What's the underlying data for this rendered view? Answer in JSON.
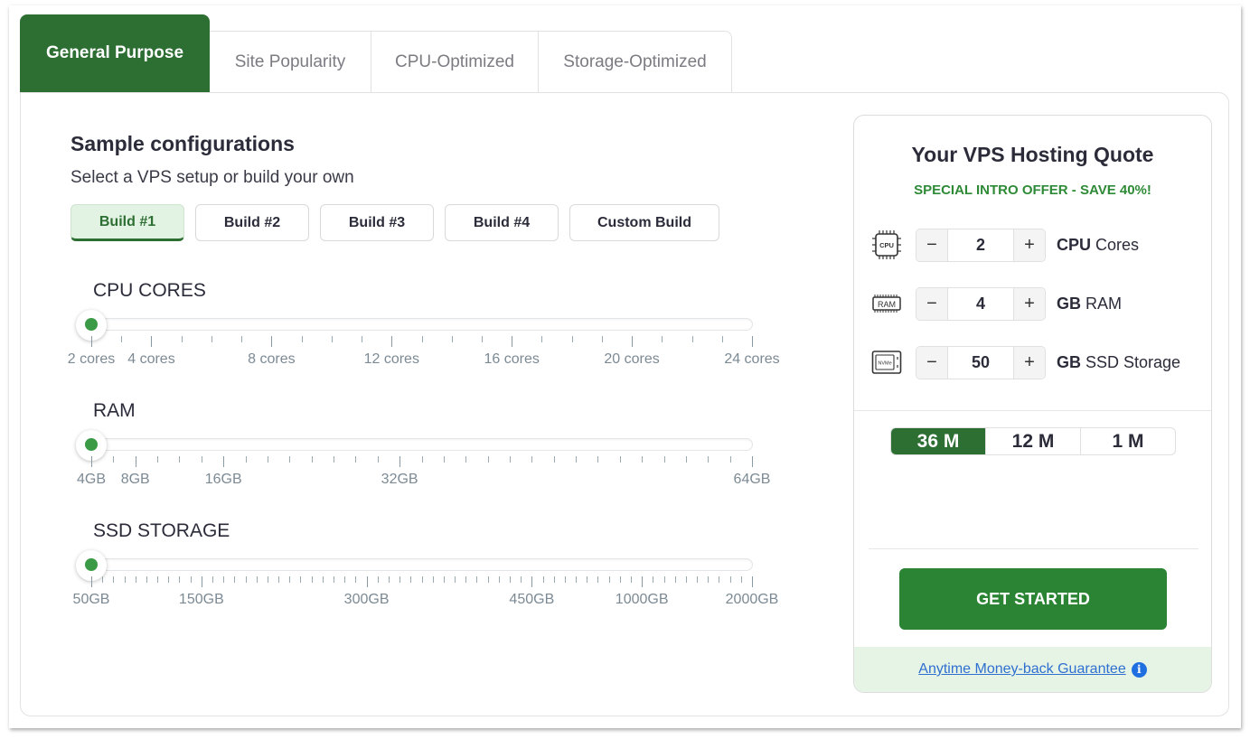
{
  "tabs": [
    {
      "label": "General Purpose",
      "active": true
    },
    {
      "label": "Site Popularity",
      "active": false
    },
    {
      "label": "CPU-Optimized",
      "active": false
    },
    {
      "label": "Storage-Optimized",
      "active": false
    }
  ],
  "configurator": {
    "title": "Sample configurations",
    "subtitle": "Select a VPS setup or build your own",
    "builds": [
      {
        "label": "Build #1",
        "selected": true
      },
      {
        "label": "Build #2",
        "selected": false
      },
      {
        "label": "Build #3",
        "selected": false
      },
      {
        "label": "Build #4",
        "selected": false
      },
      {
        "label": "Custom Build",
        "selected": false
      }
    ],
    "sliders": {
      "cpu": {
        "label": "CPU CORES",
        "value": 2,
        "min": 2,
        "max": 24,
        "tick_count": 23,
        "major_ticks": [
          2,
          4,
          8,
          12,
          16,
          20,
          24
        ],
        "tick_labels": [
          {
            "value": 2,
            "text": "2 cores"
          },
          {
            "value": 4,
            "text": "4 cores"
          },
          {
            "value": 8,
            "text": "8 cores"
          },
          {
            "value": 12,
            "text": "12 cores"
          },
          {
            "value": 16,
            "text": "16 cores"
          },
          {
            "value": 20,
            "text": "20 cores"
          },
          {
            "value": 24,
            "text": "24 cores"
          }
        ]
      },
      "ram": {
        "label": "RAM",
        "value": 4,
        "min": 4,
        "max": 64,
        "tick_count": 31,
        "major_ticks_index": [
          0,
          2,
          6,
          14,
          30
        ],
        "tick_labels": [
          {
            "index": 0,
            "text": "4GB"
          },
          {
            "index": 2,
            "text": "8GB"
          },
          {
            "index": 6,
            "text": "16GB"
          },
          {
            "index": 14,
            "text": "32GB"
          },
          {
            "index": 30,
            "text": "64GB"
          }
        ]
      },
      "ssd": {
        "label": "SSD STORAGE",
        "value": 50,
        "tick_count": 61,
        "major_ticks_index": [
          0,
          10,
          25,
          40,
          50,
          60
        ],
        "tick_labels": [
          {
            "index": 0,
            "text": "50GB"
          },
          {
            "index": 10,
            "text": "150GB"
          },
          {
            "index": 25,
            "text": "300GB"
          },
          {
            "index": 40,
            "text": "450GB"
          },
          {
            "index": 50,
            "text": "1000GB"
          },
          {
            "index": 60,
            "text": "2000GB"
          }
        ]
      }
    }
  },
  "quote": {
    "title": "Your VPS Hosting Quote",
    "offer": "SPECIAL INTRO OFFER - SAVE 40%!",
    "specs": [
      {
        "icon": "cpu-chip-icon",
        "value": "2",
        "unit_bold": "CPU",
        "unit_rest": " Cores",
        "minus": "−",
        "plus": "+"
      },
      {
        "icon": "ram-module-icon",
        "value": "4",
        "unit_bold": "GB",
        "unit_rest": " RAM",
        "minus": "−",
        "plus": "+"
      },
      {
        "icon": "nvme-ssd-icon",
        "value": "50",
        "unit_bold": "GB",
        "unit_rest": " SSD Storage",
        "minus": "−",
        "plus": "+"
      }
    ],
    "terms": [
      {
        "label": "36 M",
        "active": true
      },
      {
        "label": "12 M",
        "active": false
      },
      {
        "label": "1 M",
        "active": false
      }
    ],
    "cta": "GET STARTED",
    "guarantee": "Anytime Money-back Guarantee",
    "info_glyph": "i"
  },
  "colors": {
    "brand_green": "#2d6e33",
    "cta_green": "#2a8433",
    "offer_green": "#2e8a36",
    "slider_dot": "#3a9a45",
    "link_blue": "#2f6fd0",
    "guarantee_bg": "#e6f4e6",
    "selected_build_bg": "#e3f3e3"
  }
}
